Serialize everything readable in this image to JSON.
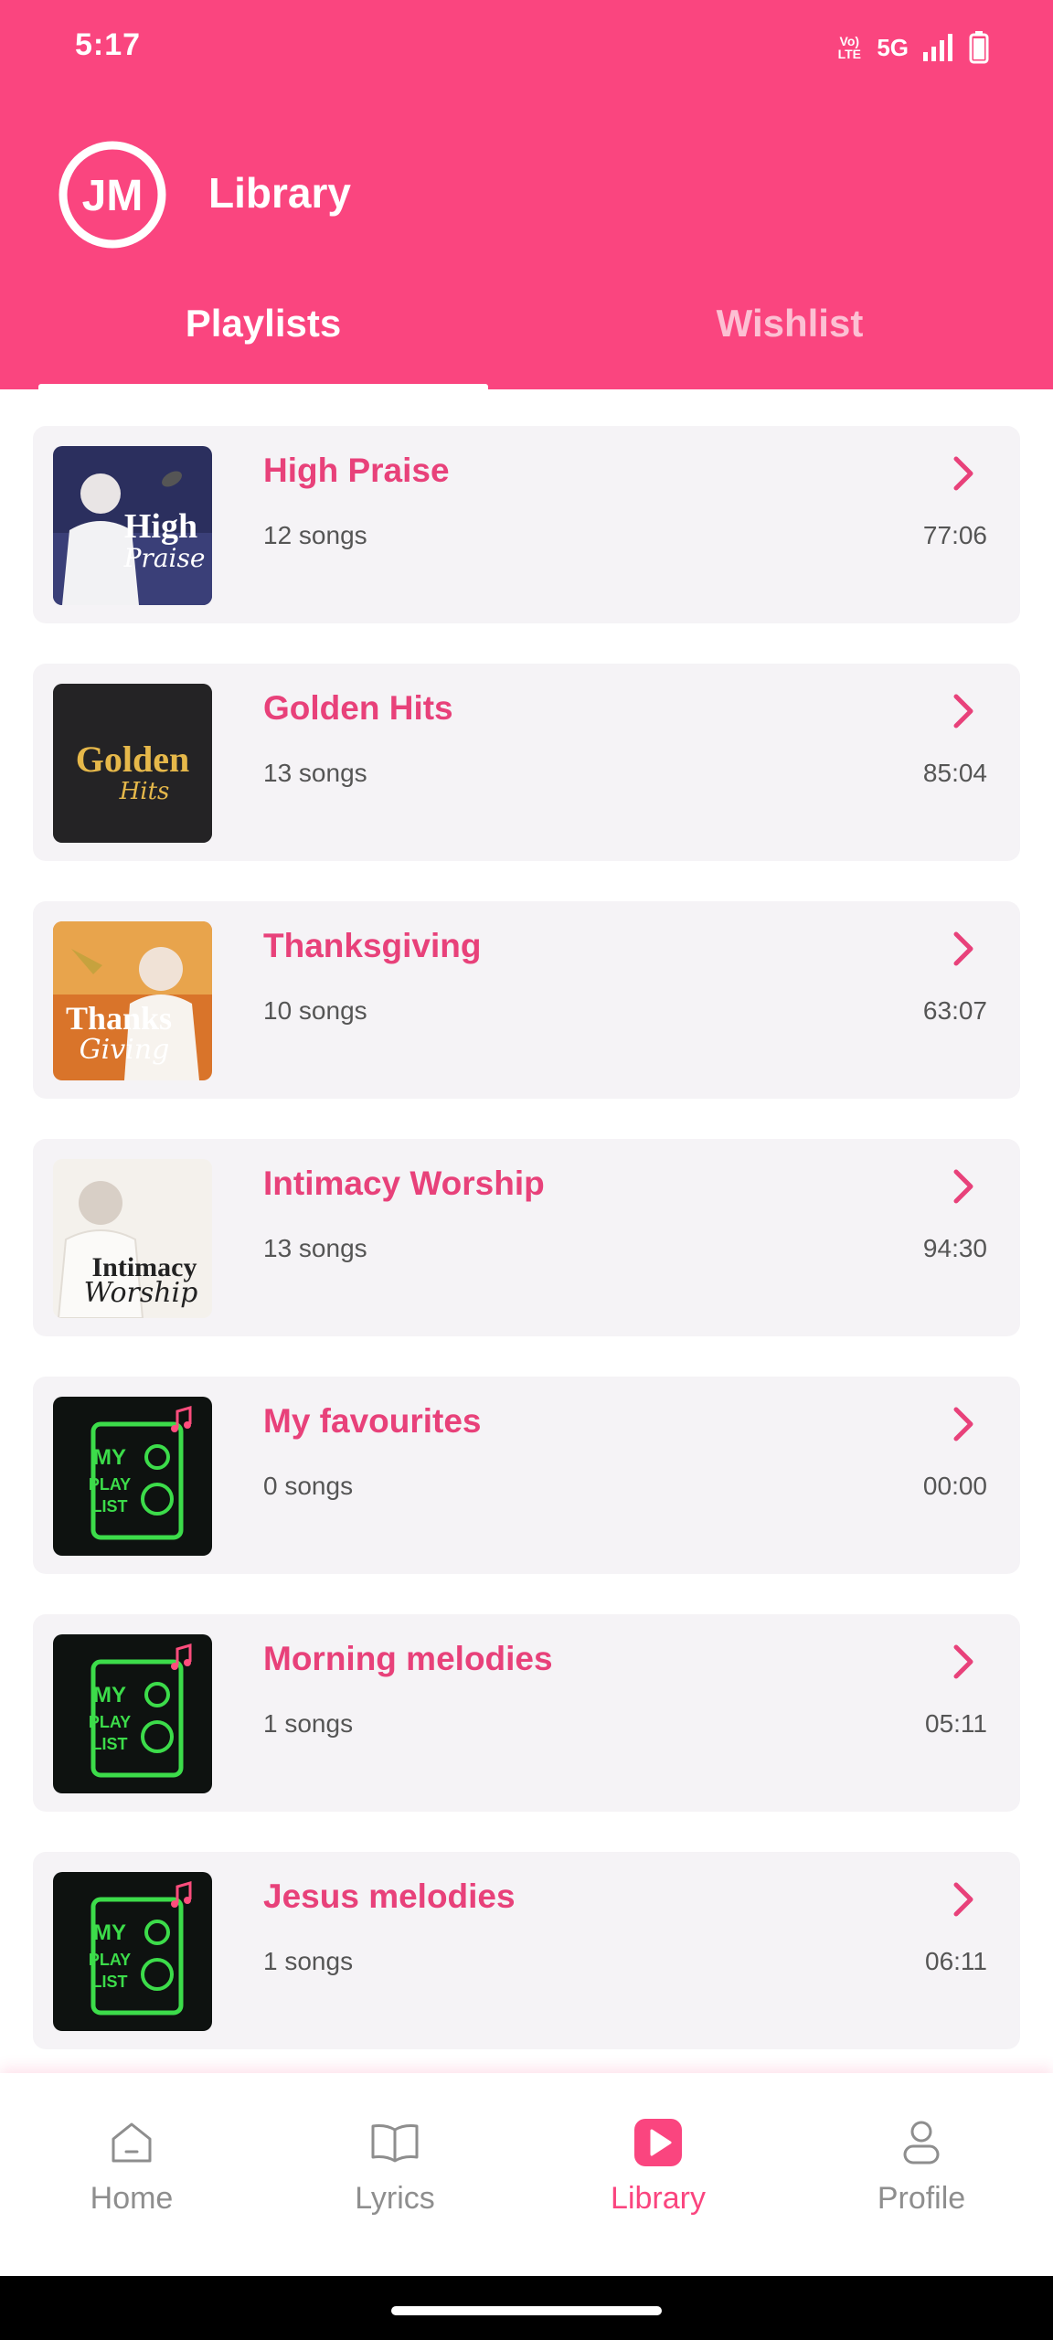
{
  "status_bar": {
    "time": "5:17",
    "volte": "VoLTE",
    "network": "5G"
  },
  "header": {
    "title": "Library",
    "logo_text": "JM"
  },
  "tabs": [
    {
      "label": "Playlists",
      "active": true
    },
    {
      "label": "Wishlist",
      "active": false
    }
  ],
  "playlists": [
    {
      "title": "High Praise",
      "count": "12 songs",
      "duration": "77:06",
      "cover_icon": "high-praise-cover"
    },
    {
      "title": "Golden Hits",
      "count": "13 songs",
      "duration": "85:04",
      "cover_icon": "golden-hits-cover"
    },
    {
      "title": "Thanksgiving",
      "count": "10 songs",
      "duration": "63:07",
      "cover_icon": "thanksgiving-cover"
    },
    {
      "title": "Intimacy Worship",
      "count": "13 songs",
      "duration": "94:30",
      "cover_icon": "intimacy-worship-cover"
    },
    {
      "title": "My favourites",
      "count": "0 songs",
      "duration": "00:00",
      "cover_icon": "my-playlist-cover"
    },
    {
      "title": "Morning melodies",
      "count": "1 songs",
      "duration": "05:11",
      "cover_icon": "my-playlist-cover"
    },
    {
      "title": "Jesus melodies",
      "count": "1 songs",
      "duration": "06:11",
      "cover_icon": "my-playlist-cover"
    }
  ],
  "covers": {
    "high_praise": [
      "High",
      "Praise"
    ],
    "golden_hits": [
      "Golden",
      "Hits"
    ],
    "thanksgiving": [
      "Thanks",
      "Giving"
    ],
    "intimacy": [
      "Intimacy",
      "Worship"
    ],
    "my_playlist": [
      "MY",
      "PLAY",
      "LIST"
    ]
  },
  "bottom_nav": [
    {
      "label": "Home",
      "icon": "home-icon",
      "active": false
    },
    {
      "label": "Lyrics",
      "icon": "book-icon",
      "active": false
    },
    {
      "label": "Library",
      "icon": "play-icon",
      "active": true
    },
    {
      "label": "Profile",
      "icon": "user-icon",
      "active": false
    }
  ],
  "colors": {
    "primary": "#fa457f",
    "title_pink": "#e8417a",
    "card_bg": "#f5f3f6",
    "text_muted": "#555555",
    "nav_inactive": "#8e8e8e"
  }
}
